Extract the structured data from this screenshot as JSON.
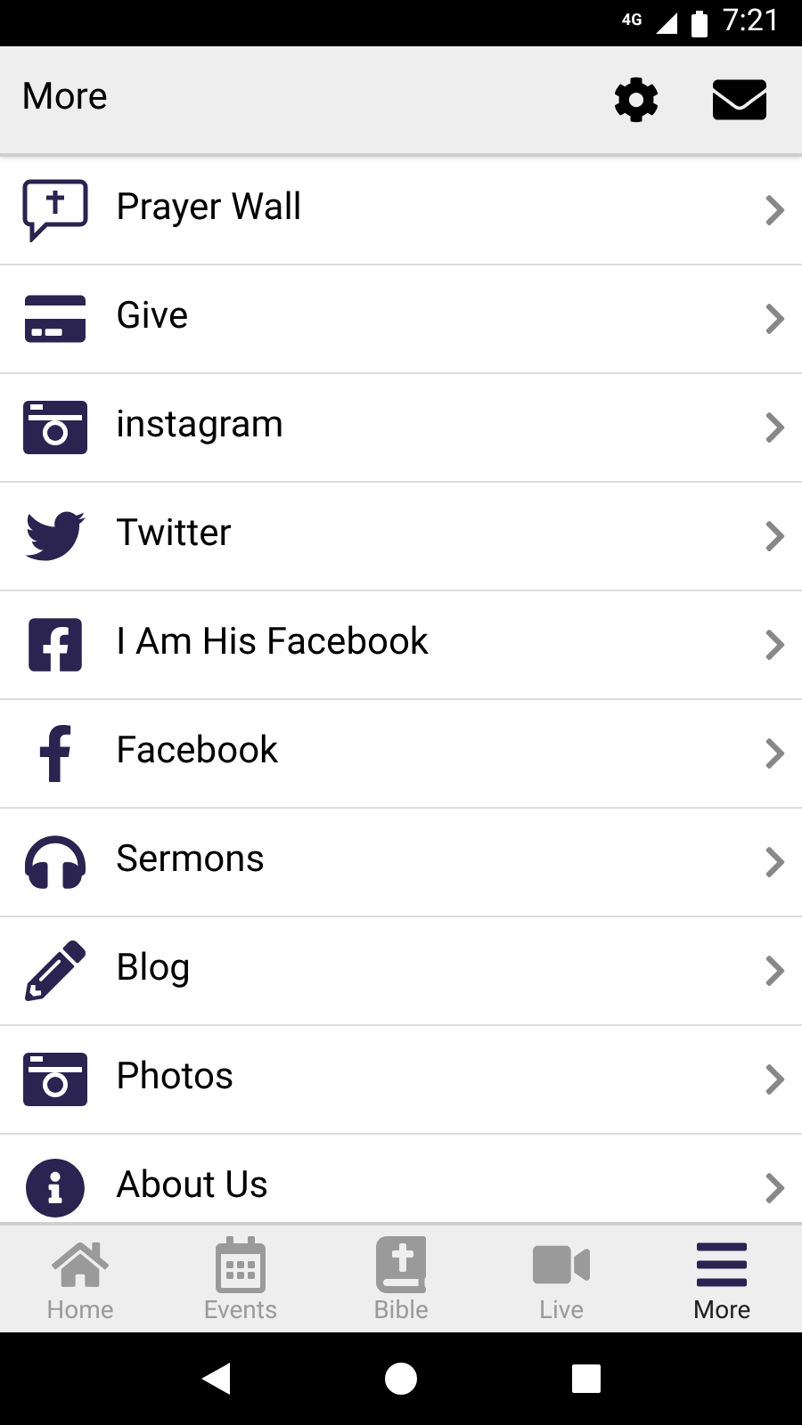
{
  "status_bar": {
    "network": "4G",
    "time": "7:21"
  },
  "header": {
    "title": "More"
  },
  "items": [
    {
      "kind": "prayer",
      "label": "Prayer Wall"
    },
    {
      "kind": "card",
      "label": "Give"
    },
    {
      "kind": "camera",
      "label": "instagram"
    },
    {
      "kind": "bird",
      "label": "Twitter"
    },
    {
      "kind": "fbsquare",
      "label": "I Am His Facebook"
    },
    {
      "kind": "fb",
      "label": "Facebook"
    },
    {
      "kind": "headphones",
      "label": "Sermons"
    },
    {
      "kind": "pencil",
      "label": "Blog"
    },
    {
      "kind": "camera",
      "label": "Photos"
    },
    {
      "kind": "info",
      "label": "About Us"
    }
  ],
  "tabs": [
    {
      "kind": "home",
      "label": "Home",
      "selected": false
    },
    {
      "kind": "calendar",
      "label": "Events",
      "selected": false
    },
    {
      "kind": "bible",
      "label": "Bible",
      "selected": false
    },
    {
      "kind": "video",
      "label": "Live",
      "selected": false
    },
    {
      "kind": "menu",
      "label": "More",
      "selected": true
    }
  ]
}
